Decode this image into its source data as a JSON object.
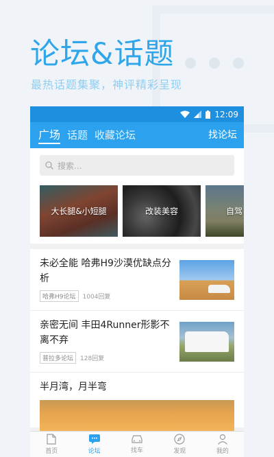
{
  "hero": {
    "title": "论坛&话题",
    "subtitle": "最热话题集聚，神评精彩呈现"
  },
  "status_bar": {
    "time": "12:09"
  },
  "app_bar": {
    "tabs": [
      {
        "label": "广场",
        "active": true
      },
      {
        "label": "话题",
        "active": false
      },
      {
        "label": "收藏论坛",
        "active": false
      }
    ],
    "find_forum": "找论坛"
  },
  "search": {
    "placeholder": "搜索..."
  },
  "forums": [
    {
      "label": "大长腿&小短腿"
    },
    {
      "label": "改装美容"
    },
    {
      "label": "自驾"
    }
  ],
  "articles": [
    {
      "title": "未必全能 哈弗H9沙漠优缺点分析",
      "tag": "哈弗H9论坛",
      "replies": "1004回复"
    },
    {
      "title": "亲密无间 丰田4Runner形影不离不弃",
      "tag": "普拉多论坛",
      "replies": "128回复"
    },
    {
      "title": "半月湾，月半弯"
    }
  ],
  "tabbar": [
    {
      "label": "首页",
      "icon": "document-icon",
      "active": false
    },
    {
      "label": "论坛",
      "icon": "chat-icon",
      "active": true
    },
    {
      "label": "找车",
      "icon": "car-icon",
      "active": false
    },
    {
      "label": "发现",
      "icon": "compass-icon",
      "active": false
    },
    {
      "label": "我的",
      "icon": "user-icon",
      "active": false
    }
  ],
  "colors": {
    "primary": "#2ca2ee",
    "status_bar": "#1d8fde",
    "hero_title": "#2ea6e9"
  }
}
